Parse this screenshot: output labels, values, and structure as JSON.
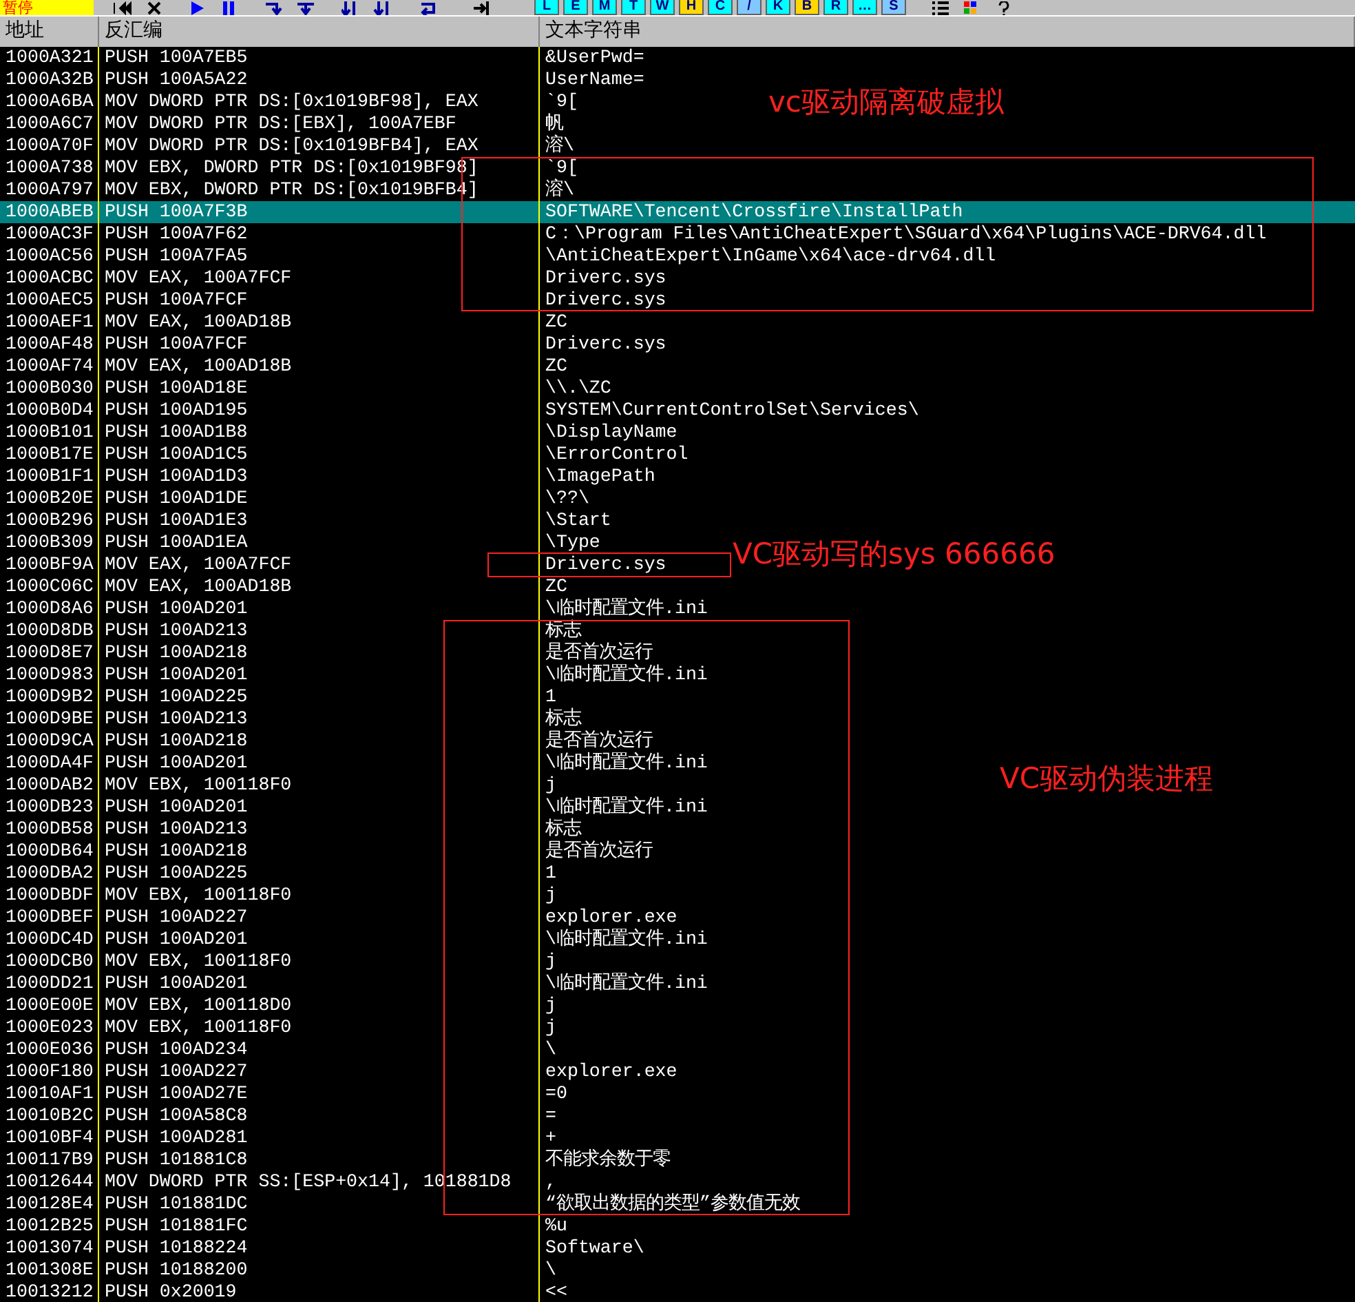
{
  "toolbar": {
    "status": "暂停",
    "window_buttons": [
      {
        "label": "L",
        "color": "#00ffff"
      },
      {
        "label": "E",
        "color": "#00ffff"
      },
      {
        "label": "M",
        "color": "#00ffff"
      },
      {
        "label": "T",
        "color": "#00ffff"
      },
      {
        "label": "W",
        "color": "#00ffff"
      },
      {
        "label": "H",
        "color": "#ffd800"
      },
      {
        "label": "C",
        "color": "#00ffff"
      },
      {
        "label": "/",
        "color": "#80c8ff"
      },
      {
        "label": "K",
        "color": "#00ffff"
      },
      {
        "label": "B",
        "color": "#ffd800"
      },
      {
        "label": "R",
        "color": "#00ffff"
      },
      {
        "label": "…",
        "color": "#00ffff"
      },
      {
        "label": "S",
        "color": "#80c8ff"
      }
    ]
  },
  "table": {
    "columns": [
      "地址",
      "反汇编",
      "文本字符串"
    ],
    "rows": [
      {
        "address": "1000A321",
        "disassembly": "PUSH 100A7EB5",
        "text": "&UserPwd=",
        "selected": false
      },
      {
        "address": "1000A32B",
        "disassembly": "PUSH 100A5A22",
        "text": "UserName=",
        "selected": false
      },
      {
        "address": "1000A6BA",
        "disassembly": "MOV DWORD PTR DS:[0x1019BF98], EAX",
        "text": "`9[",
        "selected": false
      },
      {
        "address": "1000A6C7",
        "disassembly": "MOV DWORD PTR DS:[EBX], 100A7EBF",
        "text": "帆",
        "selected": false
      },
      {
        "address": "1000A70F",
        "disassembly": "MOV DWORD PTR DS:[0x1019BFB4], EAX",
        "text": "溶\\",
        "selected": false
      },
      {
        "address": "1000A738",
        "disassembly": "MOV EBX, DWORD PTR DS:[0x1019BF98]",
        "text": "`9[",
        "selected": false
      },
      {
        "address": "1000A797",
        "disassembly": "MOV EBX, DWORD PTR DS:[0x1019BFB4]",
        "text": "溶\\",
        "selected": false
      },
      {
        "address": "1000ABEB",
        "disassembly": "PUSH 100A7F3B",
        "text": "SOFTWARE\\Tencent\\Crossfire\\InstallPath",
        "selected": true
      },
      {
        "address": "1000AC3F",
        "disassembly": "PUSH 100A7F62",
        "text": "C：\\Program Files\\AntiCheatExpert\\SGuard\\x64\\Plugins\\ACE-DRV64.dll",
        "selected": false
      },
      {
        "address": "1000AC56",
        "disassembly": "PUSH 100A7FA5",
        "text": "\\AntiCheatExpert\\InGame\\x64\\ace-drv64.dll",
        "selected": false
      },
      {
        "address": "1000ACBC",
        "disassembly": "MOV EAX, 100A7FCF",
        "text": "Driverc.sys",
        "selected": false
      },
      {
        "address": "1000AEC5",
        "disassembly": "PUSH 100A7FCF",
        "text": "Driverc.sys",
        "selected": false
      },
      {
        "address": "1000AEF1",
        "disassembly": "MOV EAX, 100AD18B",
        "text": "ZC",
        "selected": false
      },
      {
        "address": "1000AF48",
        "disassembly": "PUSH 100A7FCF",
        "text": "Driverc.sys",
        "selected": false
      },
      {
        "address": "1000AF74",
        "disassembly": "MOV EAX, 100AD18B",
        "text": "ZC",
        "selected": false
      },
      {
        "address": "1000B030",
        "disassembly": "PUSH 100AD18E",
        "text": "\\\\.\\ZC",
        "selected": false
      },
      {
        "address": "1000B0D4",
        "disassembly": "PUSH 100AD195",
        "text": "SYSTEM\\CurrentControlSet\\Services\\",
        "selected": false
      },
      {
        "address": "1000B101",
        "disassembly": "PUSH 100AD1B8",
        "text": "\\DisplayName",
        "selected": false
      },
      {
        "address": "1000B17E",
        "disassembly": "PUSH 100AD1C5",
        "text": "\\ErrorControl",
        "selected": false
      },
      {
        "address": "1000B1F1",
        "disassembly": "PUSH 100AD1D3",
        "text": "\\ImagePath",
        "selected": false
      },
      {
        "address": "1000B20E",
        "disassembly": "PUSH 100AD1DE",
        "text": "\\??\\",
        "selected": false
      },
      {
        "address": "1000B296",
        "disassembly": "PUSH 100AD1E3",
        "text": "\\Start",
        "selected": false
      },
      {
        "address": "1000B309",
        "disassembly": "PUSH 100AD1EA",
        "text": "\\Type",
        "selected": false
      },
      {
        "address": "1000BF9A",
        "disassembly": "MOV EAX, 100A7FCF",
        "text": "Driverc.sys",
        "selected": false
      },
      {
        "address": "1000C06C",
        "disassembly": "MOV EAX, 100AD18B",
        "text": "ZC",
        "selected": false
      },
      {
        "address": "1000D8A6",
        "disassembly": "PUSH 100AD201",
        "text": "\\临时配置文件.ini",
        "selected": false
      },
      {
        "address": "1000D8DB",
        "disassembly": "PUSH 100AD213",
        "text": "标志",
        "selected": false
      },
      {
        "address": "1000D8E7",
        "disassembly": "PUSH 100AD218",
        "text": "是否首次运行",
        "selected": false
      },
      {
        "address": "1000D983",
        "disassembly": "PUSH 100AD201",
        "text": "\\临时配置文件.ini",
        "selected": false
      },
      {
        "address": "1000D9B2",
        "disassembly": "PUSH 100AD225",
        "text": "1",
        "selected": false
      },
      {
        "address": "1000D9BE",
        "disassembly": "PUSH 100AD213",
        "text": "标志",
        "selected": false
      },
      {
        "address": "1000D9CA",
        "disassembly": "PUSH 100AD218",
        "text": "是否首次运行",
        "selected": false
      },
      {
        "address": "1000DA4F",
        "disassembly": "PUSH 100AD201",
        "text": "\\临时配置文件.ini",
        "selected": false
      },
      {
        "address": "1000DAB2",
        "disassembly": "MOV EBX, 100118F0",
        "text": "j",
        "selected": false
      },
      {
        "address": "1000DB23",
        "disassembly": "PUSH 100AD201",
        "text": "\\临时配置文件.ini",
        "selected": false
      },
      {
        "address": "1000DB58",
        "disassembly": "PUSH 100AD213",
        "text": "标志",
        "selected": false
      },
      {
        "address": "1000DB64",
        "disassembly": "PUSH 100AD218",
        "text": "是否首次运行",
        "selected": false
      },
      {
        "address": "1000DBA2",
        "disassembly": "PUSH 100AD225",
        "text": "1",
        "selected": false
      },
      {
        "address": "1000DBDF",
        "disassembly": "MOV EBX, 100118F0",
        "text": "j",
        "selected": false
      },
      {
        "address": "1000DBEF",
        "disassembly": "PUSH 100AD227",
        "text": "explorer.exe",
        "selected": false
      },
      {
        "address": "1000DC4D",
        "disassembly": "PUSH 100AD201",
        "text": "\\临时配置文件.ini",
        "selected": false
      },
      {
        "address": "1000DCB0",
        "disassembly": "MOV EBX, 100118F0",
        "text": "j",
        "selected": false
      },
      {
        "address": "1000DD21",
        "disassembly": "PUSH 100AD201",
        "text": "\\临时配置文件.ini",
        "selected": false
      },
      {
        "address": "1000E00E",
        "disassembly": "MOV EBX, 100118D0",
        "text": "j",
        "selected": false
      },
      {
        "address": "1000E023",
        "disassembly": "MOV EBX, 100118F0",
        "text": "j",
        "selected": false
      },
      {
        "address": "1000E036",
        "disassembly": "PUSH 100AD234",
        "text": "\\",
        "selected": false
      },
      {
        "address": "1000F180",
        "disassembly": "PUSH 100AD227",
        "text": "explorer.exe",
        "selected": false
      },
      {
        "address": "10010AF1",
        "disassembly": "PUSH 100AD27E",
        "text": "=0",
        "selected": false
      },
      {
        "address": "10010B2C",
        "disassembly": "PUSH 100A58C8",
        "text": "=",
        "selected": false
      },
      {
        "address": "10010BF4",
        "disassembly": "PUSH 100AD281",
        "text": "+",
        "selected": false
      },
      {
        "address": "100117B9",
        "disassembly": "PUSH 101881C8",
        "text": "不能求余数于零",
        "selected": false
      },
      {
        "address": "10012644",
        "disassembly": "MOV DWORD PTR SS:[ESP+0x14], 101881D8",
        "text": ",",
        "selected": false
      },
      {
        "address": "100128E4",
        "disassembly": "PUSH 101881DC",
        "text": "“欲取出数据的类型”参数值无效",
        "selected": false
      },
      {
        "address": "10012B25",
        "disassembly": "PUSH 101881FC",
        "text": "%u",
        "selected": false
      },
      {
        "address": "10013074",
        "disassembly": "PUSH 10188224",
        "text": "Software\\",
        "selected": false
      },
      {
        "address": "1001308E",
        "disassembly": "PUSH 10188200",
        "text": "\\",
        "selected": false
      },
      {
        "address": "10013212",
        "disassembly": "PUSH 0x20019",
        "text": "<<",
        "selected": false
      }
    ]
  },
  "annotations": [
    {
      "text": "vc驱动隔离破虚拟"
    },
    {
      "text": "VC驱动写的sys 666666"
    },
    {
      "text": "VC驱动伪装进程"
    }
  ]
}
